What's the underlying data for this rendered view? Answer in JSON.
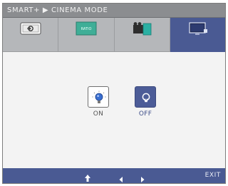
{
  "title": {
    "text": "SMART+ ▶ CINEMA MODE"
  },
  "tabs": [
    {
      "icon": "input-source-icon",
      "active": false
    },
    {
      "icon": "aspect-ratio-icon",
      "active": false,
      "icon_text": "RATIO"
    },
    {
      "icon": "cinema-mode-icon",
      "active": false
    },
    {
      "icon": "monitor-settings-icon",
      "active": true
    }
  ],
  "options": {
    "on": {
      "label": "ON",
      "icon": "bulb-on-icon",
      "selected": false
    },
    "off": {
      "label": "OFF",
      "icon": "bulb-off-icon",
      "selected": true
    }
  },
  "footer": {
    "enter_icon": "enter-arrow-icon",
    "left_icon": "left-arrow-icon",
    "right_icon": "right-arrow-icon",
    "exit_label": "EXIT"
  },
  "colors": {
    "accent": "#4a5a93",
    "titlebar": "#8b8d90",
    "tab_inactive": "#b5b7ba",
    "content_bg": "#f3f3f3"
  }
}
